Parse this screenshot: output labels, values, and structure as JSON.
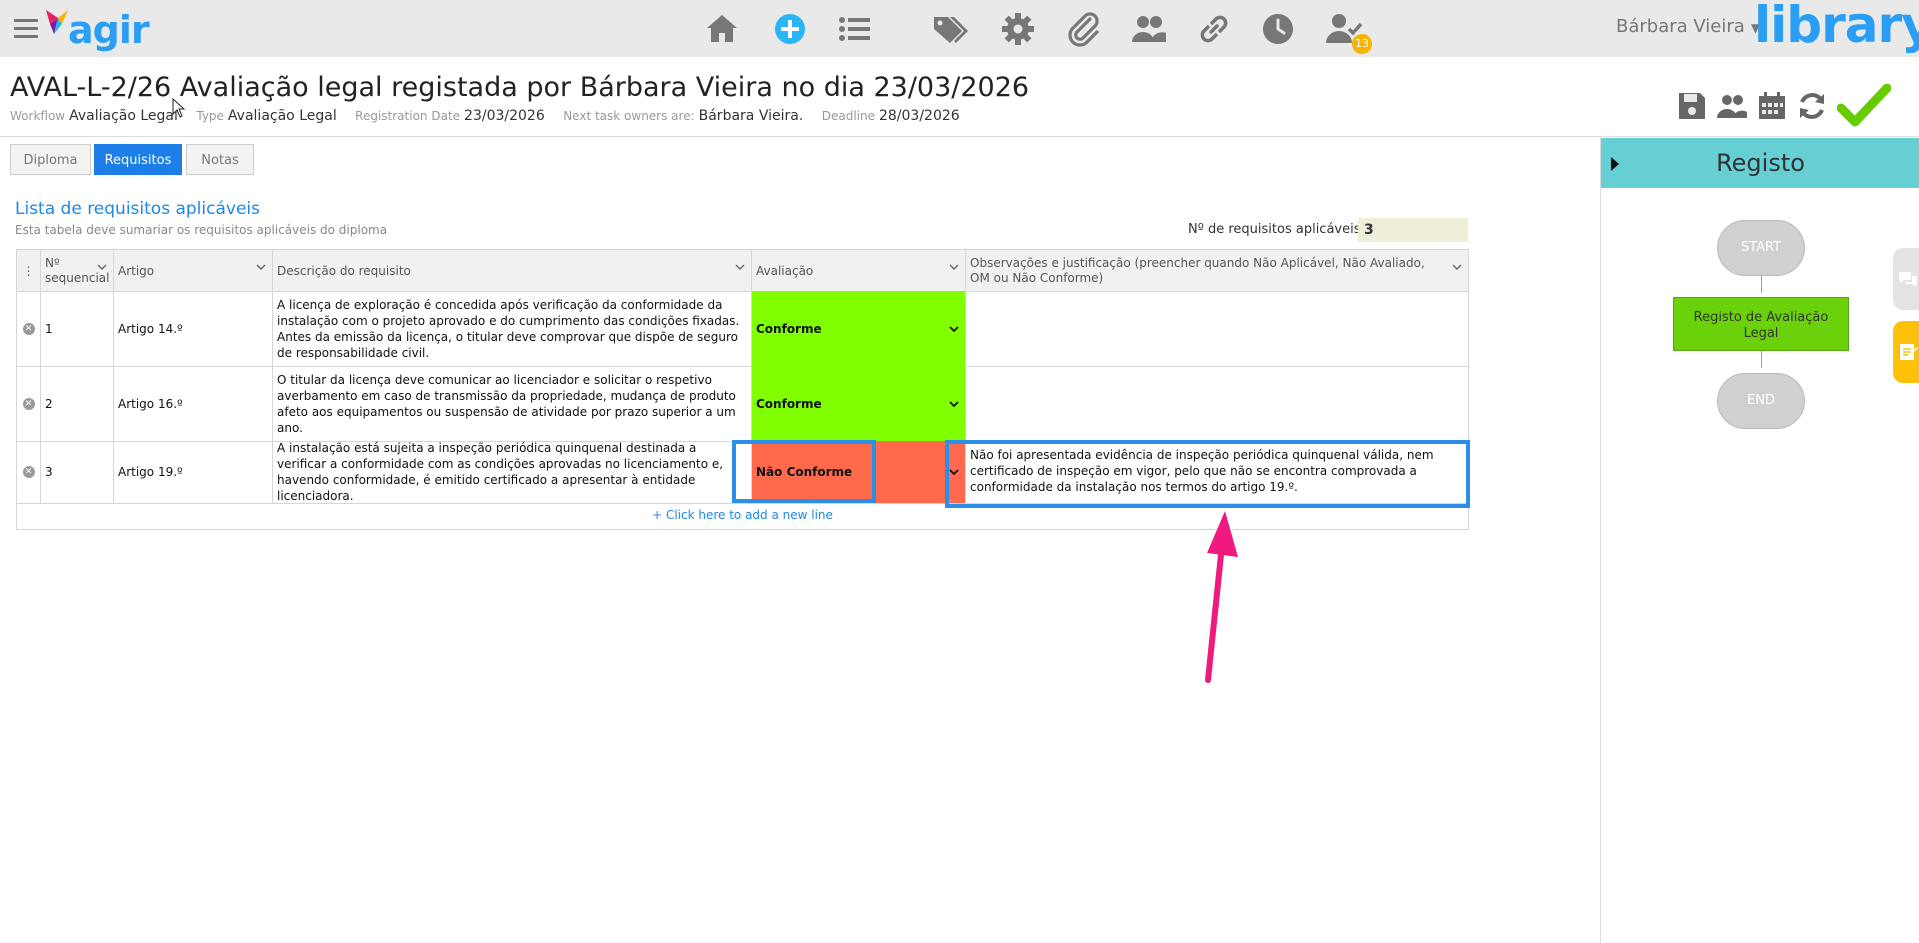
{
  "app": {
    "logo_text": "agir",
    "library_text": "library",
    "user_name": "Bárbara Vieira",
    "notification_count": "13",
    "nav_icons": [
      "home-icon",
      "add-icon",
      "list-icon",
      "tags-icon",
      "gear-icon",
      "paperclip-icon",
      "users-icon",
      "link-icon",
      "clock-icon",
      "user-check-icon"
    ]
  },
  "header": {
    "title": "AVAL-L-2/26 Avaliação legal registada por Bárbara Vieira no dia 23/03/2026",
    "workflow_label": "Workflow",
    "workflow_value": "Avaliação Legal",
    "type_label": "Type",
    "type_value": "Avaliação Legal",
    "registration_label": "Registration Date",
    "registration_value": "23/03/2026",
    "owners_label": "Next task owners are:",
    "owners_value": "Bárbara Vieira.",
    "deadline_label": "Deadline",
    "deadline_value": "28/03/2026"
  },
  "tabs": [
    {
      "label": "Diploma",
      "active": false
    },
    {
      "label": "Requisitos",
      "active": true
    },
    {
      "label": "Notas",
      "active": false
    }
  ],
  "section": {
    "title": "Lista de requisitos aplicáveis",
    "subtitle": "Esta tabela deve sumariar os requisitos aplicáveis do diploma",
    "count_label": "Nº de requisitos aplicáveis",
    "count_value": "3"
  },
  "table": {
    "columns": [
      "Nº sequencial",
      "Artigo",
      "Descrição do requisito",
      "Avaliação",
      "Observações e justificação (preencher quando Não Aplicável, Não Avaliado, OM ou Não Conforme)"
    ],
    "rows": [
      {
        "seq": "1",
        "artigo": "Artigo 14.º",
        "descricao": "A licença de exploração é concedida após verificação da conformidade da instalação com o projeto aprovado e do cumprimento das condições fixadas. Antes da emissão da licença, o titular deve comprovar que dispõe de seguro de responsabilidade civil.",
        "avaliacao": "Conforme",
        "avaliacao_color": "#7fff00",
        "observacoes": ""
      },
      {
        "seq": "2",
        "artigo": "Artigo 16.º",
        "descricao": "O titular da licença deve comunicar ao licenciador e solicitar o respetivo averbamento em caso de transmissão da propriedade, mudança de produto afeto aos equipamentos ou suspensão de atividade por prazo superior a um ano.",
        "avaliacao": "Conforme",
        "avaliacao_color": "#7fff00",
        "observacoes": ""
      },
      {
        "seq": "3",
        "artigo": "Artigo 19.º",
        "descricao": "A instalação está sujeita a inspeção periódica quinquenal destinada a verificar a conformidade com as condições aprovadas no licenciamento e, havendo conformidade, é emitido certificado a apresentar à entidade licenciadora.",
        "avaliacao": "Não Conforme",
        "avaliacao_color": "#ff6a4d",
        "observacoes": "Não foi apresentada evidência de inspeção periódica quinquenal válida, nem certificado de inspeção em vigor, pelo que não se encontra comprovada a conformidade da instalação nos termos do artigo 19.º."
      }
    ],
    "add_line": "+ Click here to add a new line"
  },
  "workflow_panel": {
    "title": "Registo",
    "start": "START",
    "task": "Registo de Avaliação Legal",
    "end": "END"
  },
  "colors": {
    "accent": "#1e7ee8",
    "panel_header": "#65cfd4",
    "conforme": "#7fff00",
    "nao_conforme": "#ff6a4d",
    "arrow": "#f0197d",
    "check": "#66cc00"
  }
}
